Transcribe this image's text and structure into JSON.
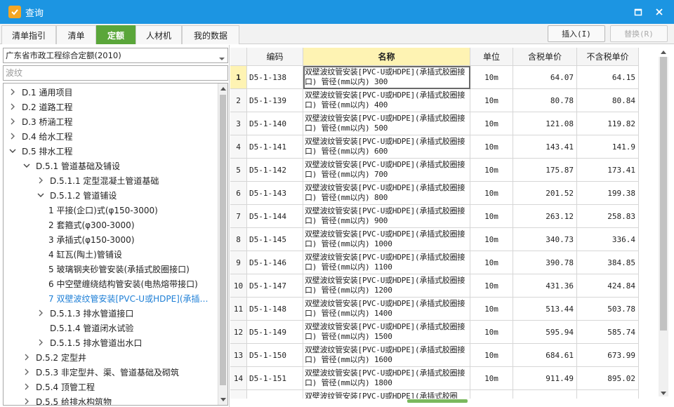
{
  "window": {
    "title": "查询"
  },
  "tabs": [
    "清单指引",
    "清单",
    "定额",
    "人材机",
    "我的数据"
  ],
  "active_tab": "定额",
  "actions": {
    "insert": "插入(I)",
    "replace": "替换(R)"
  },
  "left": {
    "combo_value": "广东省市政工程综合定额(2010)",
    "search_placeholder": "波纹",
    "tree": [
      {
        "label": "D.1 通用项目",
        "level": 0,
        "expand": "collapsed"
      },
      {
        "label": "D.2 道路工程",
        "level": 0,
        "expand": "collapsed"
      },
      {
        "label": "D.3 桥涵工程",
        "level": 0,
        "expand": "collapsed"
      },
      {
        "label": "D.4 给水工程",
        "level": 0,
        "expand": "collapsed"
      },
      {
        "label": "D.5 排水工程",
        "level": 0,
        "expand": "expanded"
      },
      {
        "label": "D.5.1 管道基础及铺设",
        "level": 1,
        "expand": "expanded"
      },
      {
        "label": "D.5.1.1 定型混凝土管道基础",
        "level": 2,
        "expand": "collapsed"
      },
      {
        "label": "D.5.1.2 管道铺设",
        "level": 2,
        "expand": "expanded"
      },
      {
        "label": "1 平接(企口)式(φ150-3000)",
        "level": 3,
        "expand": "none"
      },
      {
        "label": "2 套箍式(φ300-3000)",
        "level": 3,
        "expand": "none"
      },
      {
        "label": "3 承插式(φ150-3000)",
        "level": 3,
        "expand": "none"
      },
      {
        "label": "4 缸瓦(陶土)管铺设",
        "level": 3,
        "expand": "none"
      },
      {
        "label": "5 玻璃钢夹砂管安装(承插式胶圈接口)",
        "level": 3,
        "expand": "none"
      },
      {
        "label": "6 中空壁缠绕结构管安装(电热熔带接口)",
        "level": 3,
        "expand": "none"
      },
      {
        "label": "7 双壁波纹管安装[PVC-U或HDPE](承插…",
        "level": 3,
        "expand": "none",
        "selected": true
      },
      {
        "label": "D.5.1.3 排水管道接口",
        "level": 2,
        "expand": "collapsed"
      },
      {
        "label": "D.5.1.4 管道闭水试验",
        "level": 2,
        "expand": "none"
      },
      {
        "label": "D.5.1.5 排水管道出水口",
        "level": 2,
        "expand": "collapsed"
      },
      {
        "label": "D.5.2 定型井",
        "level": 1,
        "expand": "collapsed"
      },
      {
        "label": "D.5.3 非定型井、渠、管道基础及砌筑",
        "level": 1,
        "expand": "collapsed"
      },
      {
        "label": "D.5.4 顶管工程",
        "level": 1,
        "expand": "collapsed"
      },
      {
        "label": "D.5.5 给排水构筑物",
        "level": 1,
        "expand": "collapsed"
      }
    ]
  },
  "grid": {
    "columns": [
      "",
      "编码",
      "名称",
      "单位",
      "含税单价",
      "不含税单价"
    ],
    "rows": [
      {
        "idx": "1",
        "code": "D5-1-138",
        "name": "双壁波纹管安装[PVC-U或HDPE](承插式胶圈接口) 管径(mm以内) 300",
        "unit": "10m",
        "tax": "64.07",
        "notax": "64.15",
        "selected": true
      },
      {
        "idx": "2",
        "code": "D5-1-139",
        "name": "双壁波纹管安装[PVC-U或HDPE](承插式胶圈接口) 管径(mm以内) 400",
        "unit": "10m",
        "tax": "80.78",
        "notax": "80.84"
      },
      {
        "idx": "3",
        "code": "D5-1-140",
        "name": "双壁波纹管安装[PVC-U或HDPE](承插式胶圈接口) 管径(mm以内) 500",
        "unit": "10m",
        "tax": "121.08",
        "notax": "119.82"
      },
      {
        "idx": "4",
        "code": "D5-1-141",
        "name": "双壁波纹管安装[PVC-U或HDPE](承插式胶圈接口) 管径(mm以内) 600",
        "unit": "10m",
        "tax": "143.41",
        "notax": "141.9"
      },
      {
        "idx": "5",
        "code": "D5-1-142",
        "name": "双壁波纹管安装[PVC-U或HDPE](承插式胶圈接口) 管径(mm以内) 700",
        "unit": "10m",
        "tax": "175.87",
        "notax": "173.41"
      },
      {
        "idx": "6",
        "code": "D5-1-143",
        "name": "双壁波纹管安装[PVC-U或HDPE](承插式胶圈接口) 管径(mm以内) 800",
        "unit": "10m",
        "tax": "201.52",
        "notax": "199.38"
      },
      {
        "idx": "7",
        "code": "D5-1-144",
        "name": "双壁波纹管安装[PVC-U或HDPE](承插式胶圈接口) 管径(mm以内) 900",
        "unit": "10m",
        "tax": "263.12",
        "notax": "258.83"
      },
      {
        "idx": "8",
        "code": "D5-1-145",
        "name": "双壁波纹管安装[PVC-U或HDPE](承插式胶圈接口) 管径(mm以内) 1000",
        "unit": "10m",
        "tax": "340.73",
        "notax": "336.4"
      },
      {
        "idx": "9",
        "code": "D5-1-146",
        "name": "双壁波纹管安装[PVC-U或HDPE](承插式胶圈接口) 管径(mm以内) 1100",
        "unit": "10m",
        "tax": "390.78",
        "notax": "384.85"
      },
      {
        "idx": "10",
        "code": "D5-1-147",
        "name": "双壁波纹管安装[PVC-U或HDPE](承插式胶圈接口) 管径(mm以内) 1200",
        "unit": "10m",
        "tax": "431.36",
        "notax": "424.84"
      },
      {
        "idx": "11",
        "code": "D5-1-148",
        "name": "双壁波纹管安装[PVC-U或HDPE](承插式胶圈接口) 管径(mm以内) 1400",
        "unit": "10m",
        "tax": "513.44",
        "notax": "503.78"
      },
      {
        "idx": "12",
        "code": "D5-1-149",
        "name": "双壁波纹管安装[PVC-U或HDPE](承插式胶圈接口) 管径(mm以内) 1500",
        "unit": "10m",
        "tax": "595.94",
        "notax": "585.74"
      },
      {
        "idx": "13",
        "code": "D5-1-150",
        "name": "双壁波纹管安装[PVC-U或HDPE](承插式胶圈接口) 管径(mm以内) 1600",
        "unit": "10m",
        "tax": "684.61",
        "notax": "673.99"
      },
      {
        "idx": "14",
        "code": "D5-1-151",
        "name": "双壁波纹管安装[PVC-U或HDPE](承插式胶圈接口) 管径(mm以内) 1800",
        "unit": "10m",
        "tax": "911.49",
        "notax": "895.02"
      },
      {
        "idx": "",
        "code": "",
        "name": "双壁波纹管安装[PVC-U或HDPE](承插式胶圈",
        "unit": "",
        "tax": "",
        "notax": ""
      }
    ]
  },
  "colors": {
    "titlebar": "#1c95e2",
    "active_tab": "#5aa63a",
    "name_header": "#fef3b3",
    "tree_selected": "#1c7ed6"
  },
  "icons": {
    "app": "app-logo-icon",
    "maximize": "maximize-icon",
    "close": "close-icon"
  }
}
